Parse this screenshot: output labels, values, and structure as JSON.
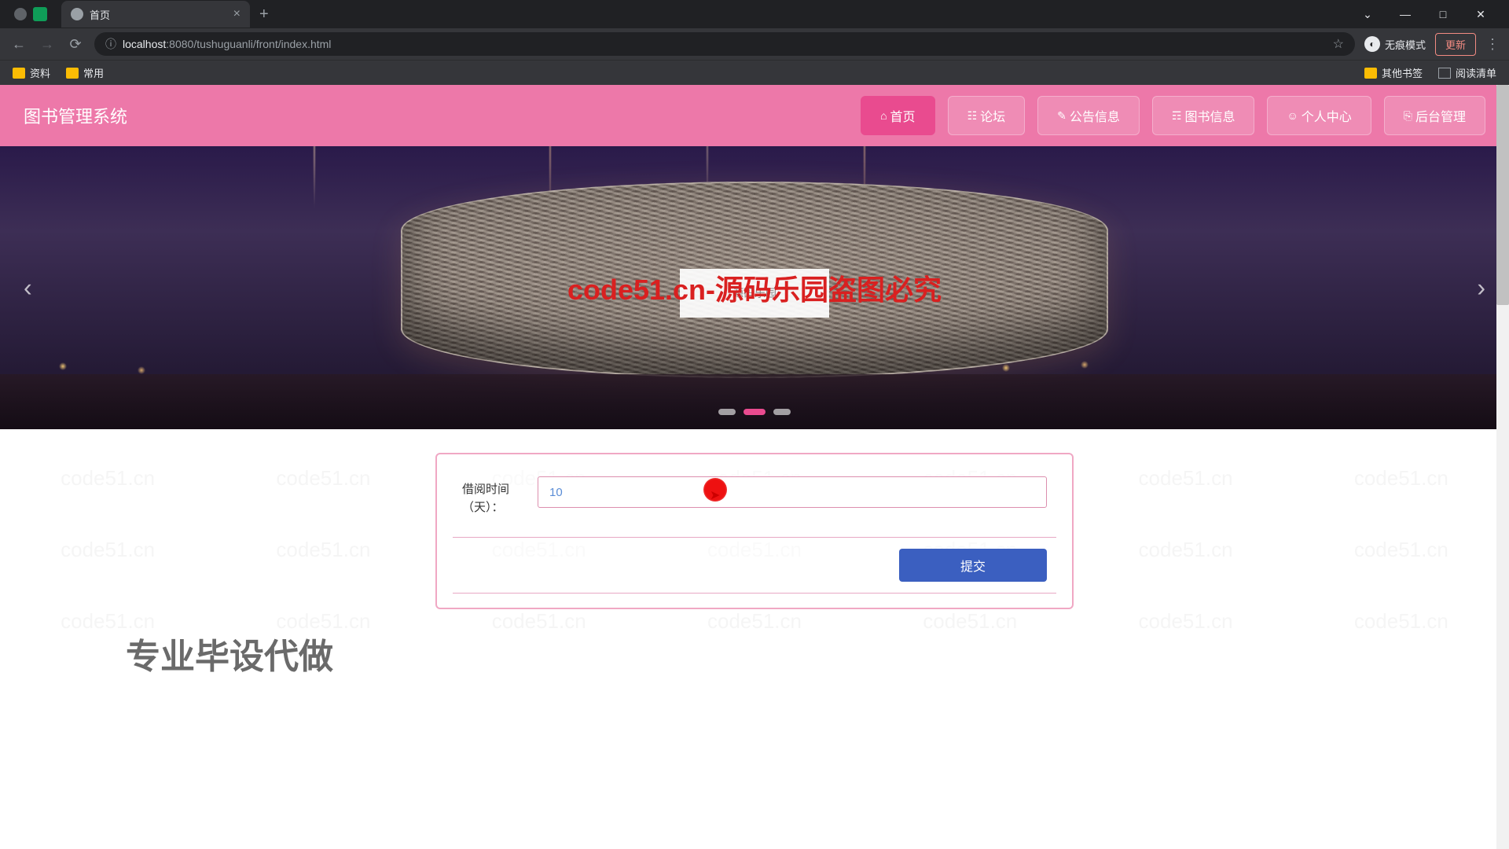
{
  "browser": {
    "tab_title": "首页",
    "url_host": "localhost",
    "url_port": ":8080",
    "url_path": "/tushuguanli/front/index.html",
    "incognito_label": "无痕模式",
    "update_label": "更新"
  },
  "bookmarks": {
    "left": [
      "资料",
      "常用"
    ],
    "right": [
      "其他书签",
      "阅读清单"
    ]
  },
  "header": {
    "site_title": "图书管理系统",
    "nav": [
      {
        "icon": "⌂",
        "label": "首页",
        "active": true
      },
      {
        "icon": "☷",
        "label": "论坛",
        "active": false
      },
      {
        "icon": "✎",
        "label": "公告信息",
        "active": false
      },
      {
        "icon": "☶",
        "label": "图书信息",
        "active": false
      },
      {
        "icon": "☺",
        "label": "个人中心",
        "active": false
      },
      {
        "icon": "⎘",
        "label": "后台管理",
        "active": false
      }
    ]
  },
  "watermark": {
    "text": "code51.cn",
    "center": "code51.cn-源码乐园盗图必究",
    "center_box": "源码乐园"
  },
  "form": {
    "label": "借阅时间（天）：",
    "input_value": "10",
    "submit_label": "提交"
  },
  "footer": {
    "heading": "专业毕设代做"
  }
}
